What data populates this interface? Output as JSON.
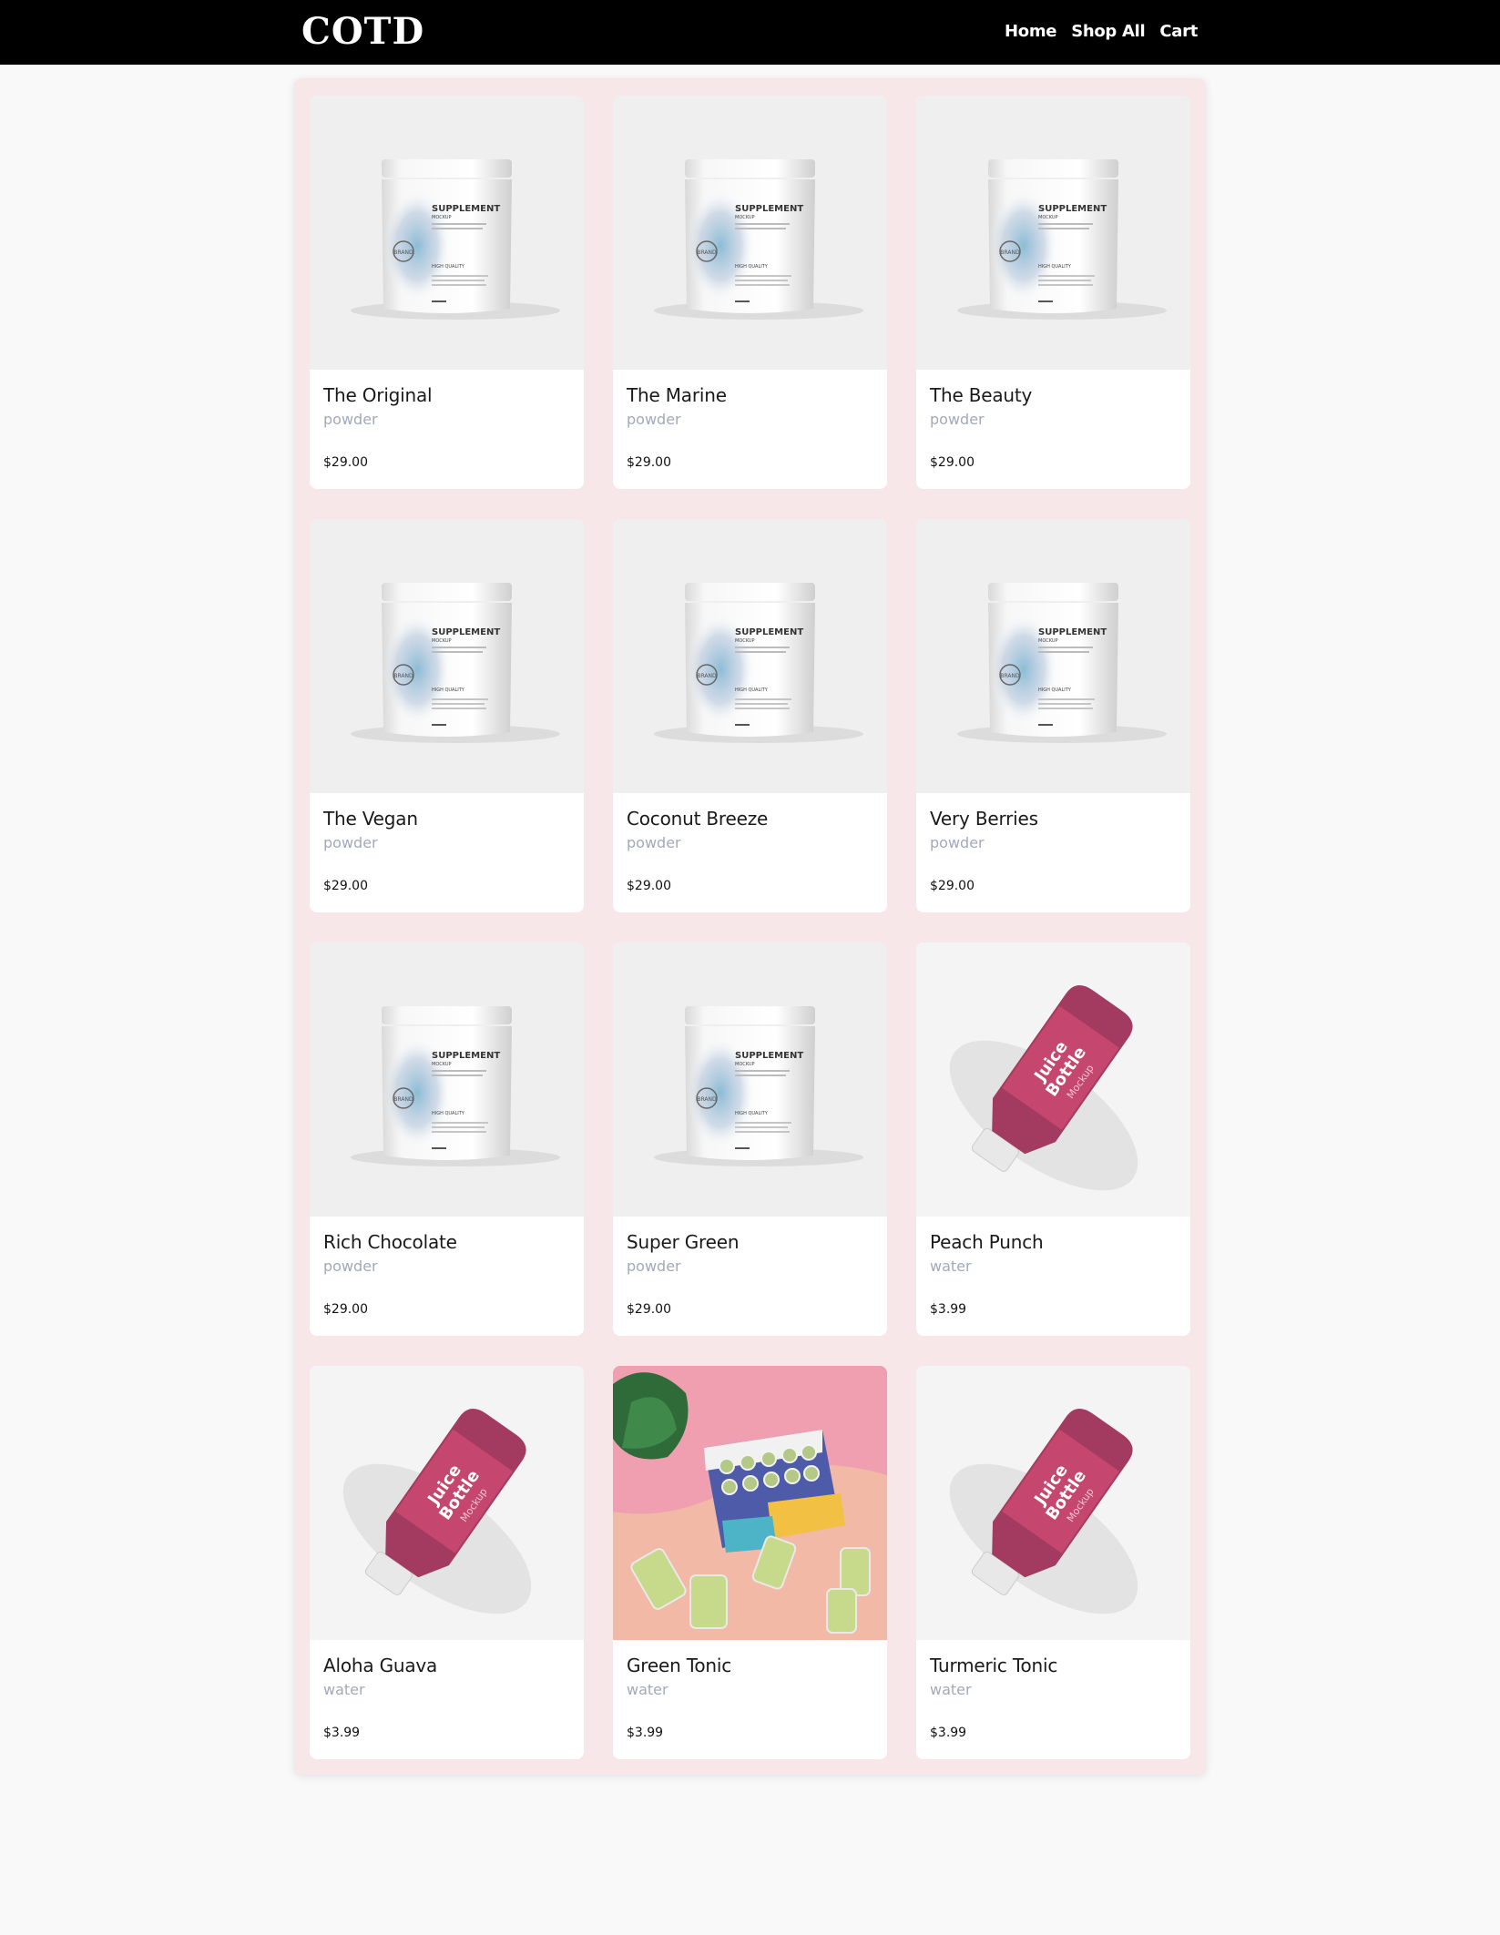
{
  "header": {
    "logo": "COTD",
    "nav": [
      {
        "label": "Home"
      },
      {
        "label": "Shop All"
      },
      {
        "label": "Cart"
      }
    ]
  },
  "products": [
    {
      "name": "The Original",
      "category": "powder",
      "price": "$29.00",
      "image": "supplement-jar"
    },
    {
      "name": "The Marine",
      "category": "powder",
      "price": "$29.00",
      "image": "supplement-jar"
    },
    {
      "name": "The Beauty",
      "category": "powder",
      "price": "$29.00",
      "image": "supplement-jar"
    },
    {
      "name": "The Vegan",
      "category": "powder",
      "price": "$29.00",
      "image": "supplement-jar"
    },
    {
      "name": "Coconut Breeze",
      "category": "powder",
      "price": "$29.00",
      "image": "supplement-jar"
    },
    {
      "name": "Very Berries",
      "category": "powder",
      "price": "$29.00",
      "image": "supplement-jar"
    },
    {
      "name": "Rich Chocolate",
      "category": "powder",
      "price": "$29.00",
      "image": "supplement-jar"
    },
    {
      "name": "Super Green",
      "category": "powder",
      "price": "$29.00",
      "image": "supplement-jar"
    },
    {
      "name": "Peach Punch",
      "category": "water",
      "price": "$3.99",
      "image": "juice-bottle"
    },
    {
      "name": "Aloha Guava",
      "category": "water",
      "price": "$3.99",
      "image": "juice-bottle"
    },
    {
      "name": "Green Tonic",
      "category": "water",
      "price": "$3.99",
      "image": "bottle-box-photo"
    },
    {
      "name": "Turmeric Tonic",
      "category": "water",
      "price": "$3.99",
      "image": "juice-bottle"
    }
  ],
  "image_text": {
    "supplement": {
      "line1": "SUPPLEMENT",
      "line2": "MOCKUP",
      "line3": "HIGH QUALITY",
      "badge": "BRAND"
    },
    "juice": {
      "line1": "Juice",
      "line2": "Bottle",
      "line3": "Mockup"
    }
  },
  "colors": {
    "header_bg": "#000000",
    "page_bg": "#f9f9f9",
    "panel_bg": "#f8e7e8",
    "category_text": "#a3a9bb",
    "bottle_label": "#c5466f"
  }
}
